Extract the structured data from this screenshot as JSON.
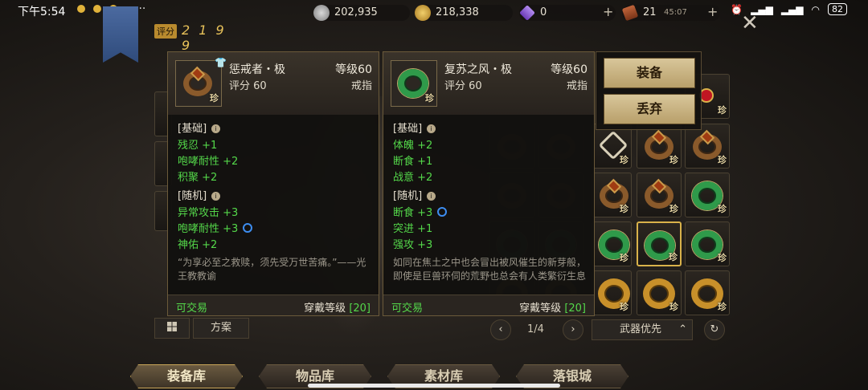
{
  "status_bar": {
    "time": "下午5:54",
    "more": "···",
    "battery": "82"
  },
  "currencies": [
    {
      "icon": "silver-coin-icon",
      "value": "202,935"
    },
    {
      "icon": "gold-coin-icon",
      "value": "218,338"
    },
    {
      "icon": "purple-gem-icon",
      "value": "0"
    },
    {
      "icon": "ticket-icon",
      "value": "21",
      "timer": "45:07"
    }
  ],
  "close_glyph": "✕",
  "score": {
    "label": "评分",
    "value": "2 1 9 9"
  },
  "card_left": {
    "name": "惩戒者・极",
    "level": "等级60",
    "score": "评分 60",
    "type": "戒指",
    "base_title": "[基础]",
    "base_stats": [
      "残忍 +1",
      "咆哮耐性 +2",
      "积聚 +2"
    ],
    "random_title": "[随机]",
    "random_stats": [
      "异常攻击 +3",
      "咆哮耐性 +3",
      "神佑 +2"
    ],
    "flavor": "“为享必至之救赎，须先受万世苦痛。”——光王教教谕",
    "tradeable": "可交易",
    "wear_label": "穿戴等级",
    "wear_level": "[20]",
    "icon_badge": "珍"
  },
  "card_right": {
    "name": "复苏之风・极",
    "level": "等级60",
    "score": "评分 60",
    "type": "戒指",
    "base_title": "[基础]",
    "base_stats": [
      "体魄 +2",
      "断食 +1",
      "战意 +2"
    ],
    "random_title": "[随机]",
    "random_stats": [
      "断食 +3",
      "突进 +1",
      "强攻 +3"
    ],
    "flavor": "如同在焦土之中也会冒出被风催生的新芽般，即使是巨兽环伺的荒野也总会有人类繁衍生息",
    "tradeable": "可交易",
    "wear_label": "穿戴等级",
    "wear_level": "[20]",
    "icon_badge": "珍"
  },
  "action_menu": {
    "equip": "装备",
    "discard": "丢弃"
  },
  "bottom_controls": {
    "scheme": "方案",
    "page": "1/4",
    "sort": "武器优先"
  },
  "grid_badge": "珍",
  "tabs": [
    "装备库",
    "物品库",
    "素材库",
    "落银城"
  ],
  "active_tab": "装备库"
}
